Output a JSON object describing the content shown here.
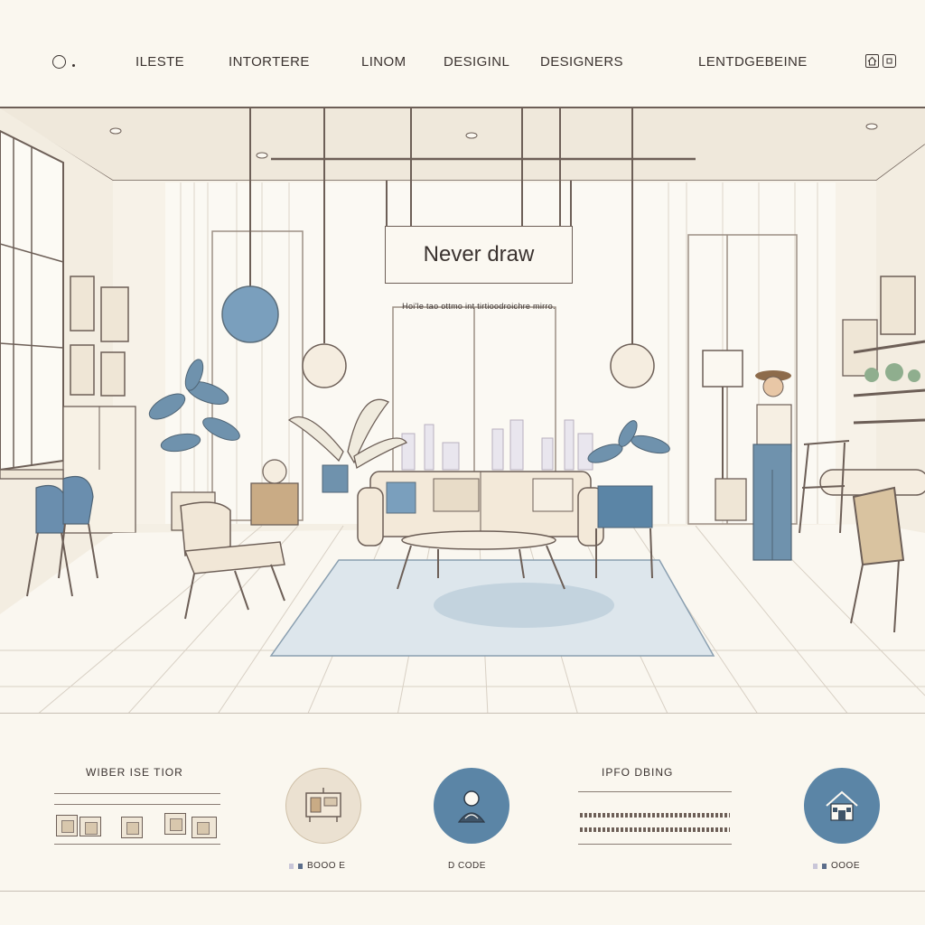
{
  "nav": {
    "items": [
      "ILESTE",
      "INTORTERE",
      "LINOM",
      "DESIGINL",
      "DESIGNERS",
      "LENTDGEBEINE"
    ],
    "icons": [
      "search-icon",
      "home-icon",
      "bag-icon"
    ]
  },
  "hero": {
    "title": "Never draw",
    "subtitle": "Hoi'le tao ottmo int tirtioodroichre mirro."
  },
  "sections": {
    "left_heading": "WIBER ISE TIOR",
    "right_heading": "IPFO DBING",
    "captions": [
      "BOOO E",
      "D CODE",
      "OOOE"
    ]
  },
  "colors": {
    "accent_blue": "#5b85a6",
    "background": "#faf7ef",
    "line": "#6d5f57"
  }
}
